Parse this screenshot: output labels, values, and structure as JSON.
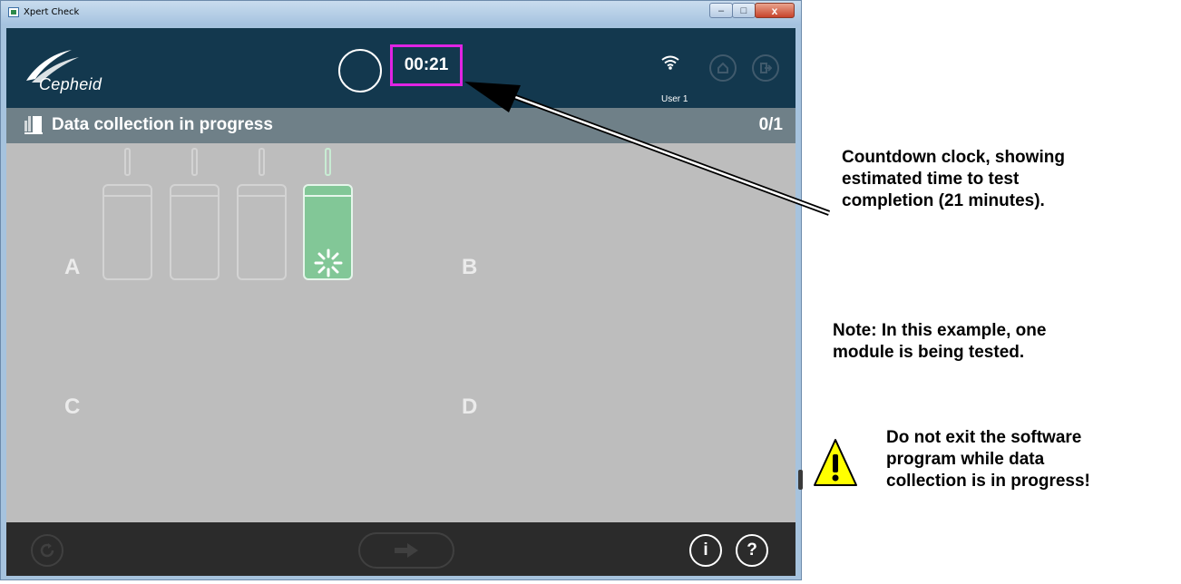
{
  "window": {
    "title": "Xpert Check",
    "controls": {
      "minimize": "–",
      "maximize": "□",
      "close": "x"
    }
  },
  "header": {
    "logo_text": "Cepheid",
    "timer": "00:21",
    "user": "User 1",
    "icons": [
      "wifi-icon",
      "home-icon",
      "logout-icon"
    ]
  },
  "status": {
    "title": "Data collection in progress",
    "count": "0/1"
  },
  "modules": {
    "labels": [
      "A",
      "B",
      "C",
      "D"
    ],
    "group_a_cartridges": [
      {
        "state": "idle"
      },
      {
        "state": "idle"
      },
      {
        "state": "idle"
      },
      {
        "state": "in-progress"
      }
    ]
  },
  "footer": {
    "info_label": "i",
    "help_label": "?",
    "icons": [
      "refresh-icon",
      "next-arrow-icon",
      "info-icon",
      "help-icon"
    ]
  },
  "annotations": {
    "countdown": [
      "Countdown clock, showing",
      "estimated time to test",
      "completion (21 minutes)."
    ],
    "note": [
      "Note: In this example, one",
      "module is being tested."
    ],
    "warning": [
      "Do not exit the software",
      "program while data",
      "collection is in progress!"
    ]
  },
  "colors": {
    "header_bg": "#13384e",
    "status_bg": "#6f8088",
    "module_area_bg": "#bdbdbd",
    "active_cartridge": "#82c797",
    "timer_highlight": "#e024e3",
    "warning_yellow": "#ffff00"
  }
}
